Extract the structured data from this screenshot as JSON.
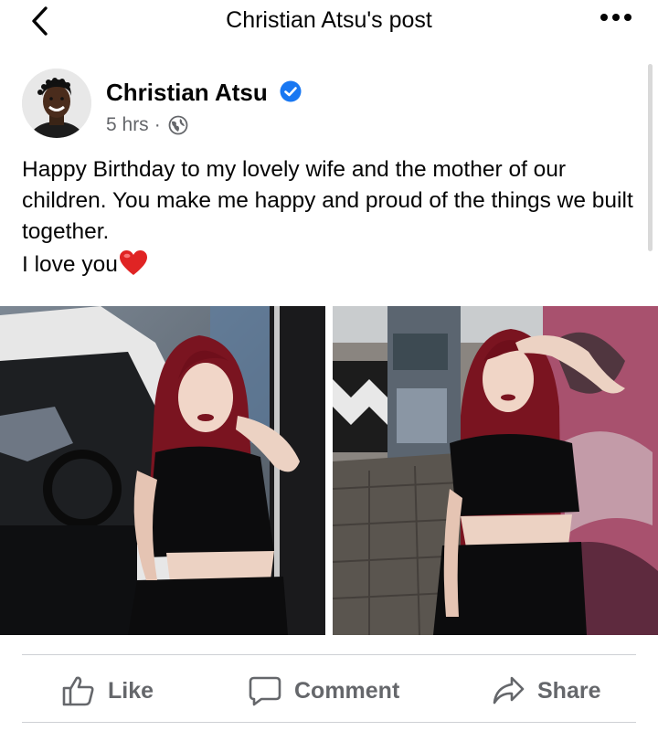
{
  "header": {
    "title": "Christian Atsu's post",
    "back_icon": "chevron-left-icon",
    "more_icon": "ellipsis-icon"
  },
  "post": {
    "author": "Christian Atsu",
    "verified": true,
    "time": "5 hrs",
    "separator": "·",
    "privacy_icon": "globe-icon",
    "text_line1": "Happy Birthday to my lovely wife and the mother of our children. You make me happy and proud of the things we built together.",
    "text_line2": "I love you",
    "emoji": "red-heart",
    "photos": [
      {
        "description": "Woman with red hair in black crop top leaning on car door"
      },
      {
        "description": "Woman with red hair in black outfit posing against graffiti wall"
      }
    ]
  },
  "actions": {
    "like": "Like",
    "comment": "Comment",
    "share": "Share"
  },
  "colors": {
    "text": "#050505",
    "secondary": "#65676b",
    "verified_blue": "#1877f2",
    "divider": "#ced0d4",
    "heart": "#e02424"
  }
}
